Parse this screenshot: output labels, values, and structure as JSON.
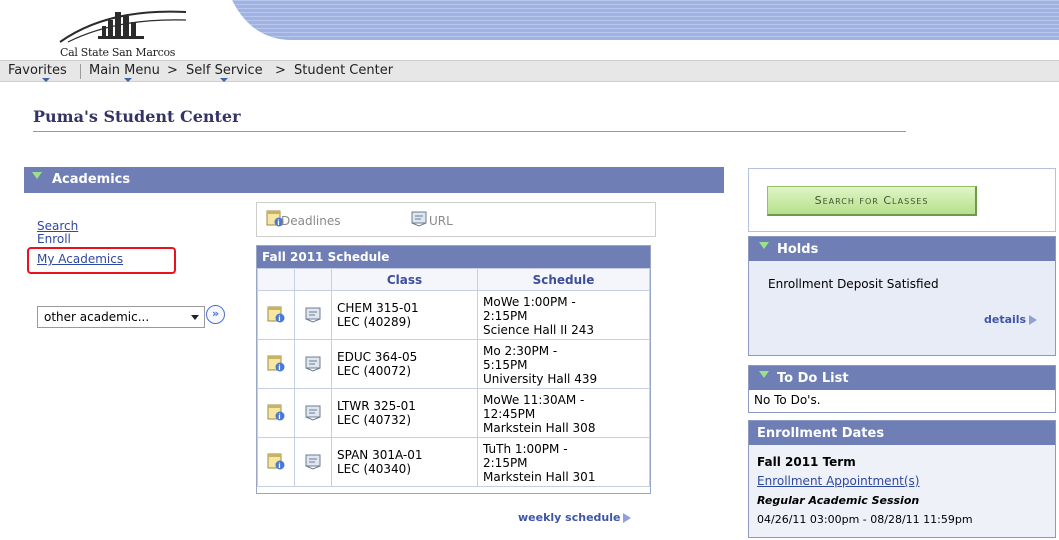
{
  "header": {
    "logo_text": "Cal State San Marcos",
    "nav": {
      "favorites": "Favorites",
      "main_menu": "Main Menu",
      "self_service": "Self Service",
      "student_center": "Student Center",
      "separator": ">"
    }
  },
  "page": {
    "title": "Puma's Student Center"
  },
  "academics": {
    "heading": "Academics",
    "links": {
      "search": "Search",
      "enroll": "Enroll",
      "my_academics": "My Academics"
    },
    "other_select": "other academic...",
    "go_button": "»",
    "tools": {
      "deadlines": "Deadlines",
      "url": "URL"
    }
  },
  "schedule": {
    "title": "Fall 2011 Schedule",
    "columns": {
      "class": "Class",
      "schedule": "Schedule"
    },
    "rows": [
      {
        "class": "CHEM 315-01\nLEC (40289)",
        "schedule": "MoWe 1:00PM -\n2:15PM\nScience Hall II 243"
      },
      {
        "class": "EDUC 364-05\nLEC (40072)",
        "schedule": "Mo 2:30PM -\n5:15PM\nUniversity Hall 439"
      },
      {
        "class": "LTWR 325-01\nLEC (40732)",
        "schedule": "MoWe 11:30AM -\n12:45PM\nMarkstein Hall 308"
      },
      {
        "class": "SPAN 301A-01\nLEC (40340)",
        "schedule": "TuTh 1:00PM -\n2:15PM\nMarkstein Hall 301"
      }
    ],
    "weekly_link": "weekly schedule"
  },
  "sidebar": {
    "search_button": "Search for Classes",
    "holds": {
      "heading": "Holds",
      "item": "Enrollment Deposit Satisfied",
      "details": "details"
    },
    "todo": {
      "heading": "To Do List",
      "text": "No To Do's."
    },
    "enrollment": {
      "heading": "Enrollment Dates",
      "term": "Fall 2011 Term",
      "appointment_link": "Enrollment Appointment(s)",
      "session": "Regular Academic Session",
      "dates": "04/26/11 03:00pm - 08/28/11 11:59pm"
    }
  },
  "colors": {
    "panel_header": "#6f7fb5",
    "link": "#2e49a0",
    "highlight": "#e8121c",
    "search_button": "#b6e08b",
    "title": "#333366"
  },
  "icons": [
    "calendar-info-icon",
    "url-book-icon",
    "triangle-down-icon",
    "arrow-right-icon",
    "go-arrows-icon"
  ]
}
